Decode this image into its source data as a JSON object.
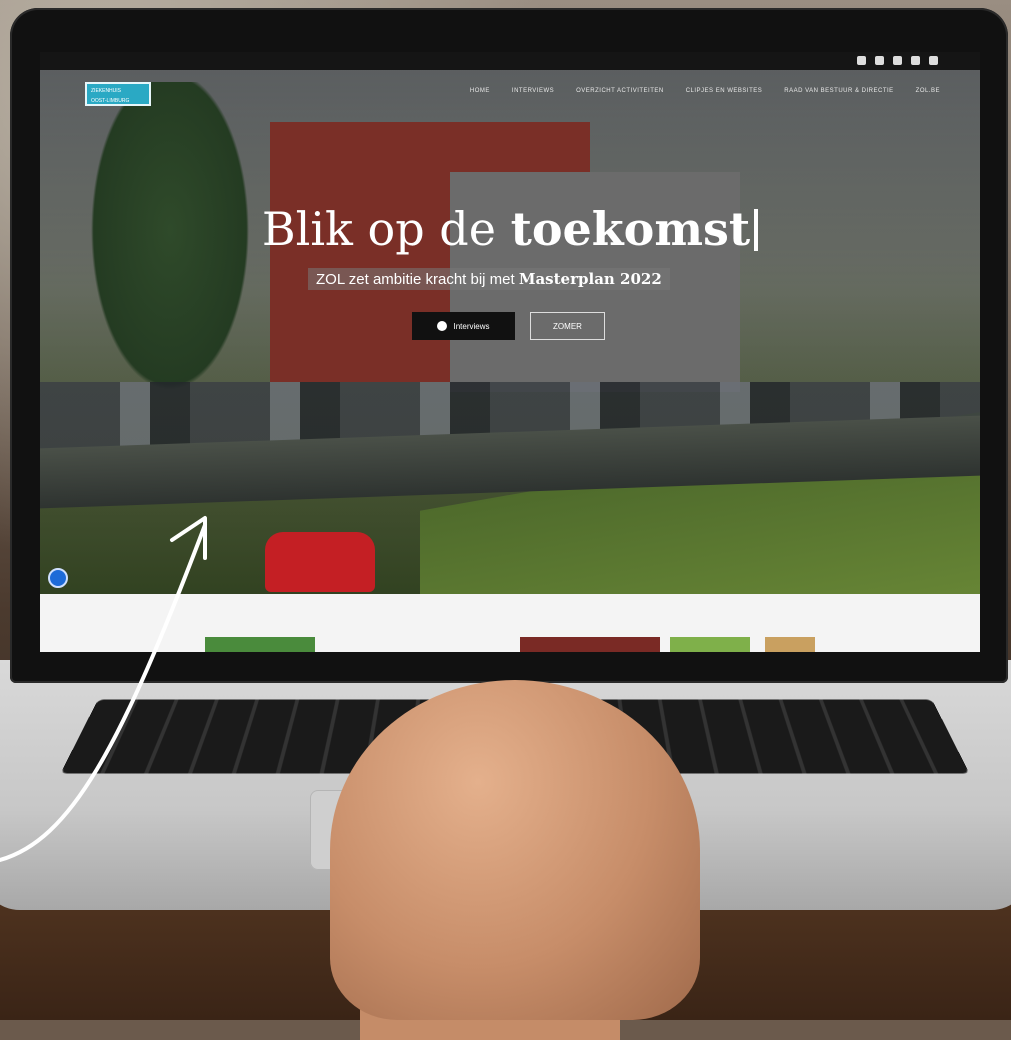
{
  "screen": {
    "logo": {
      "lines": [
        "ZIEKENHUIS",
        "OOST-LIMBURG"
      ]
    },
    "nav": {
      "items": [
        "HOME",
        "INTERVIEWS",
        "OVERZICHT ACTIVITEITEN",
        "CLIPJES EN WEBSITES",
        "RAAD VAN BESTUUR & DIRECTIE",
        "ZOL.BE"
      ]
    },
    "social_icons": [
      "facebook-icon",
      "twitter-icon",
      "instagram-icon",
      "linkedin-icon",
      "youtube-icon"
    ],
    "hero": {
      "title_light": "Blik op de",
      "title_bold": "toekomst",
      "subtitle_light": "ZOL zet ambitie kracht bij met",
      "subtitle_bold": "Masterplan 2022",
      "button_primary": "Interviews",
      "button_secondary": "ZOMER"
    },
    "colors": {
      "logo_accent": "#2aa9c4",
      "button_dark": "#111111",
      "accessibility_badge": "#1d6bd8"
    }
  }
}
